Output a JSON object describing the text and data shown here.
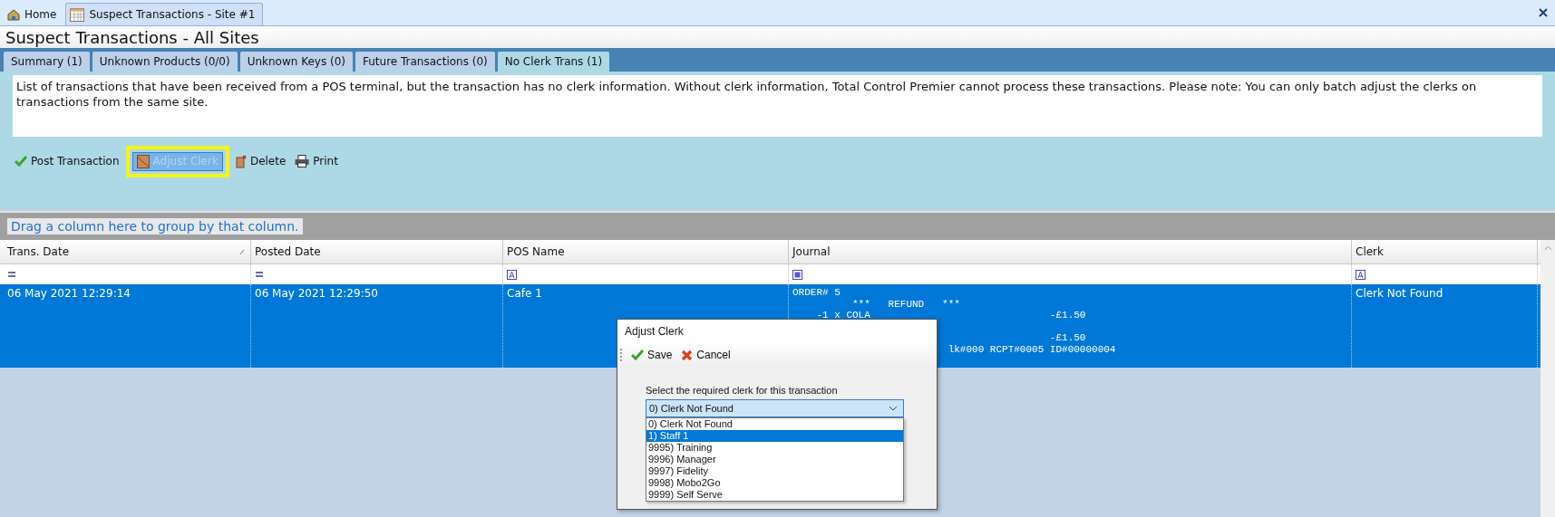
{
  "doc_tabs": [
    {
      "label": "Home",
      "selected": false
    },
    {
      "label": "Suspect Transactions - Site #1",
      "selected": true
    }
  ],
  "title": "Suspect Transactions - All Sites",
  "tabs": [
    {
      "label": "Summary (1)",
      "selected": false
    },
    {
      "label": "Unknown Products (0/0)",
      "selected": false
    },
    {
      "label": "Unknown Keys (0)",
      "selected": false
    },
    {
      "label": "Future Transactions (0)",
      "selected": false
    },
    {
      "label": "No Clerk Trans (1)",
      "selected": true
    }
  ],
  "description": "List of transactions that have been received from a POS terminal, but the transaction has no clerk information.  Without clerk information, Total Control Premier cannot process these transactions.  Please note: You can only batch adjust the clerks on transactions from the same site.",
  "toolbar": [
    {
      "label": "Post Transaction",
      "disabled": false,
      "highlighted": false
    },
    {
      "label": "Adjust Clerk",
      "disabled": true,
      "highlighted": true
    },
    {
      "label": "Delete",
      "disabled": false,
      "highlighted": false
    },
    {
      "label": "Print",
      "disabled": false,
      "highlighted": false
    }
  ],
  "group_hint": "Drag a column here to group by that column.",
  "table": {
    "columns": [
      {
        "label": "Trans. Date",
        "sorted": true
      },
      {
        "label": "Posted Date",
        "sorted": false
      },
      {
        "label": "POS Name",
        "sorted": false
      },
      {
        "label": "Journal",
        "sorted": false
      },
      {
        "label": "Clerk",
        "sorted": false
      }
    ],
    "rows": [
      {
        "selected": true,
        "trans_date": "06 May 2021 12:29:14",
        "posted_date": "06 May 2021 12:29:50",
        "pos_name": "Cafe 1",
        "journal": [
          "ORDER# 5",
          "          ***   REFUND   ***",
          "    -1 x COLA                              -£1.50",
          "                                           -£1.50",
          "                          lk#000 RCPT#0005 ID#00000004"
        ],
        "clerk": "Clerk Not Found"
      }
    ]
  },
  "dialog": {
    "title": "Adjust Clerk",
    "save": "Save",
    "cancel": "Cancel",
    "prompt": "Select the required clerk for this transaction",
    "value": "0) Clerk Not Found",
    "options": [
      {
        "label": "0) Clerk Not Found",
        "highlighted": false
      },
      {
        "label": "1) Staff 1",
        "highlighted": true
      },
      {
        "label": "9995) Training",
        "highlighted": false
      },
      {
        "label": "9996) Manager",
        "highlighted": false
      },
      {
        "label": "9997) Fidelity",
        "highlighted": false
      },
      {
        "label": "9998) Mobo2Go",
        "highlighted": false
      },
      {
        "label": "9999) Self Serve",
        "highlighted": false
      }
    ]
  }
}
